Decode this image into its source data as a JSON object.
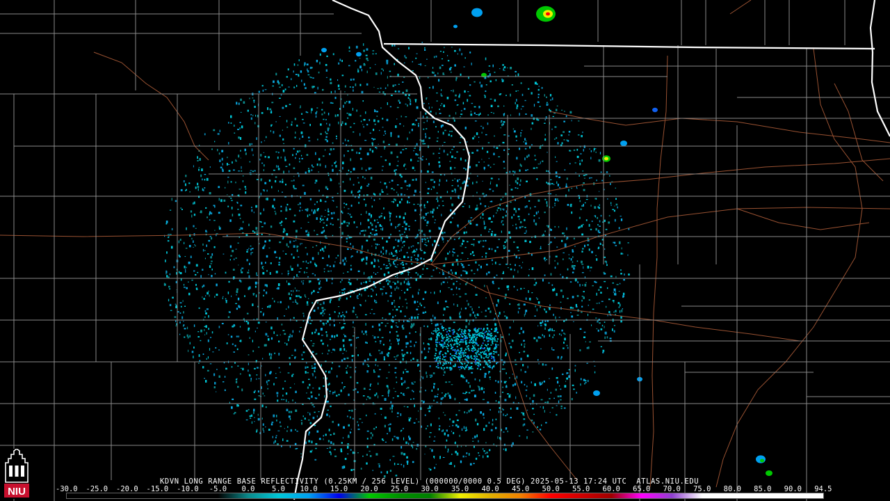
{
  "product": {
    "title": "KDVN LONG RANGE BASE REFLECTIVITY (0.25KM / 256 LEVEL) (000000/0000 0.5 DEG) 2025-05-13 17:24 UTC  ATLAS.NIU.EDU",
    "station": "KDVN",
    "elevation": "0.5 DEG",
    "valid_time": "2025-05-13 17:24 UTC",
    "source": "ATLAS.NIU.EDU"
  },
  "logo": {
    "text": "NIU",
    "icon": "niu-tower-logo"
  },
  "legend": {
    "ticks": [
      "-30.0",
      "-25.0",
      "-20.0",
      "-15.0",
      "-10.0",
      "-5.0",
      "0.0",
      "5.0",
      "10.0",
      "15.0",
      "20.0",
      "25.0",
      "30.0",
      "35.0",
      "40.0",
      "45.0",
      "50.0",
      "55.0",
      "60.0",
      "65.0",
      "70.0",
      "75.0",
      "80.0",
      "85.0",
      "90.0",
      "94.5"
    ],
    "colors": [
      "#000000",
      "#000000",
      "#000000",
      "#000000",
      "#000000",
      "#000000",
      "#0b8a8c",
      "#00c8d8",
      "#00a0f0",
      "#0000ee",
      "#00c800",
      "#009000",
      "#008000",
      "#f0f000",
      "#e0b000",
      "#f08000",
      "#ff0000",
      "#d00000",
      "#a00000",
      "#ff00ff",
      "#9040d0",
      "#ffffff",
      "#ffffff",
      "#ffffff",
      "#ffffff",
      "#ffffff"
    ]
  },
  "map": {
    "line_colors": {
      "state_border": "#ffffff",
      "county": "#8a8a8a",
      "highway": "#9a5232"
    }
  }
}
